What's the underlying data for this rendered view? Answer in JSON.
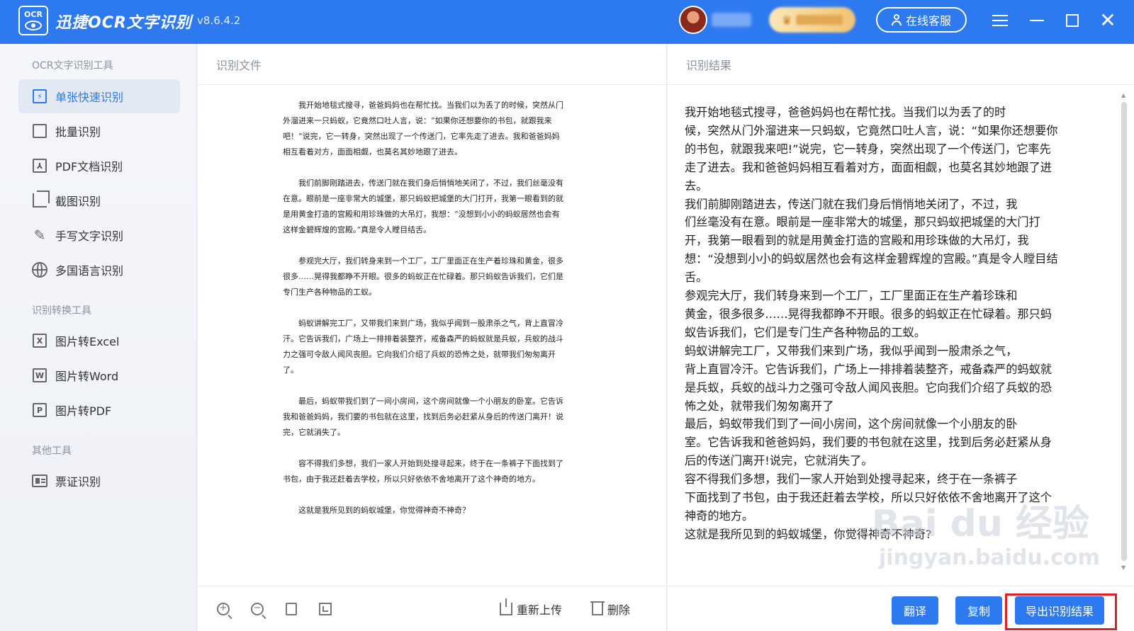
{
  "app": {
    "logo_text": "OCR",
    "title": "迅捷OCR文字识别",
    "version": "v8.6.4.2",
    "service_label": "在线客服"
  },
  "sidebar": {
    "sections": [
      {
        "title": "OCR文字识别工具",
        "items": [
          {
            "label": "单张快速识别",
            "icon": "fast-scan-icon",
            "glyph": "⚡",
            "active": true
          },
          {
            "label": "批量识别",
            "icon": "batch-icon",
            "glyph": ""
          },
          {
            "label": "PDF文档识别",
            "icon": "pdf-doc-icon",
            "glyph": ""
          },
          {
            "label": "截图识别",
            "icon": "crop-icon",
            "glyph": ""
          },
          {
            "label": "手写文字识别",
            "icon": "pen-icon",
            "glyph": "✎"
          },
          {
            "label": "多国语言识别",
            "icon": "globe-icon",
            "glyph": ""
          }
        ]
      },
      {
        "title": "识别转换工具",
        "items": [
          {
            "label": "图片转Excel",
            "icon": "excel-icon",
            "glyph": "X"
          },
          {
            "label": "图片转Word",
            "icon": "word-icon",
            "glyph": "W"
          },
          {
            "label": "图片转PDF",
            "icon": "pdf-icon",
            "glyph": "P"
          }
        ]
      },
      {
        "title": "其他工具",
        "items": [
          {
            "label": "票证识别",
            "icon": "ticket-icon",
            "glyph": ""
          }
        ]
      }
    ]
  },
  "left_panel": {
    "header": "识别文件",
    "document_paragraphs": [
      "我开始地毯式搜寻，爸爸妈妈也在帮忙找。当我们以为丢了的时候，突然从门外溜进来一只蚂蚁，它竟然口吐人言，说：“如果你还想要你的书包，就跟我来吧！”说完，它一转身，突然出现了一个传送门，它率先走了进去。我和爸爸妈妈相互看着对方，面面相觑，也莫名其妙地跟了进去。",
      "我们前脚刚踏进去，传送门就在我们身后悄悄地关闭了，不过，我们丝毫没有在意。眼前是一座非常大的城堡，那只蚂蚁把城堡的大门打开，我第一眼看到的就是用黄金打造的宫殿和用珍珠做的大吊灯，我想：“没想到小小的蚂蚁居然也会有这样金碧辉煌的宫殿。”真是令人瞠目结舌。",
      "参观完大厅，我们转身来到一个工厂，工厂里面正在生产着珍珠和黄金，很多很多……晃得我都睁不开眼。很多的蚂蚁正在忙碌着。那只蚂蚁告诉我们，它们是专门生产各种物品的工蚁。",
      "蚂蚁讲解完工厂，又带我们来到广场，我似乎闻到一股肃杀之气，背上直冒冷汗。它告诉我们，广场上一排排着装整齐，戒备森严的蚂蚁就是兵蚁，兵蚁的战斗力之强可令敌人闻风丧胆。它向我们介绍了兵蚁的恐怖之处，就带我们匆匆离开了。",
      "最后，蚂蚁带我们到了一间小房间，这个房间就像一个小朋友的卧室。它告诉我和爸爸妈妈，我们要的书包就在这里，找到后务必赶紧从身后的传送门离开！说完，它就消失了。",
      "容不得我们多想，我们一家人开始到处搜寻起来，终于在一条裤子下面找到了书包，由于我还赶着去学校，所以只好依依不舍地离开了这个神奇的地方。",
      "这就是我所见到的蚂蚁城堡，你觉得神奇不神奇？"
    ],
    "toolbar": {
      "reupload_label": "重新上传",
      "delete_label": "删除"
    }
  },
  "right_panel": {
    "header": "识别结果",
    "result_lines": "我开始地毯式搜寻，爸爸妈妈也在帮忙找。当我们以为丢了的时\n候，突然从门外溜进来一只蚂蚁，它竟然口吐人言，说：“如果你还想要你\n的书包，就跟我来吧!”说完，它一转身，突然出现了一个传送门，它率先\n走了进去。我和爸爸妈妈相互看着对方，面面相觑，也莫名其妙地跟了进\n去。\n我们前脚刚踏进去，传送门就在我们身后悄悄地关闭了，不过，我\n们丝毫没有在意。眼前是一座非常大的城堡，那只蚂蚁把城堡的大门打\n开，我第一眼看到的就是用黄金打造的宫殿和用珍珠做的大吊灯，我\n想：“没想到小小的蚂蚁居然也会有这样金碧辉煌的宫殿。”真是令人瞠目结\n舌。\n参观完大厅，我们转身来到一个工厂，工厂里面正在生产着珍珠和\n黄金，很多很多……晃得我都睁不开眼。很多的蚂蚁正在忙碌着。那只蚂\n蚁告诉我们，它们是专门生产各种物品的工蚁。\n蚂蚁讲解完工厂，又带我们来到广场，我似乎闻到一股肃杀之气，\n背上直冒冷汗。它告诉我们，广场上一排排着装整齐，戒备森严的蚂蚁就\n是兵蚁，兵蚁的战斗力之强可令敌人闻风丧胆。它向我们介绍了兵蚁的恐\n怖之处，就带我们匆匆离开了\n最后，蚂蚁带我们到了一间小房间，这个房间就像一个小朋友的卧\n室。它告诉我和爸爸妈妈，我们要的书包就在这里，找到后务必赶紧从身\n后的传送门离开!说完，它就消失了。\n容不得我们多想，我们一家人开始到处搜寻起来，终于在一条裤子\n下面找到了书包，由于我还赶着去学校，所以只好依依不舍地离开了这个\n神奇的地方。\n这就是我所见到的蚂蚁城堡，你觉得神奇不神奇?",
    "buttons": {
      "translate": "翻译",
      "copy": "复制",
      "export": "导出识别结果"
    }
  },
  "watermark": {
    "main": "Bai du 经验",
    "sub": "jingyan.baidu.com"
  },
  "colors": {
    "brand": "#2d79f0",
    "highlight": "#e21f25",
    "vip_gold": "#f0c372"
  }
}
